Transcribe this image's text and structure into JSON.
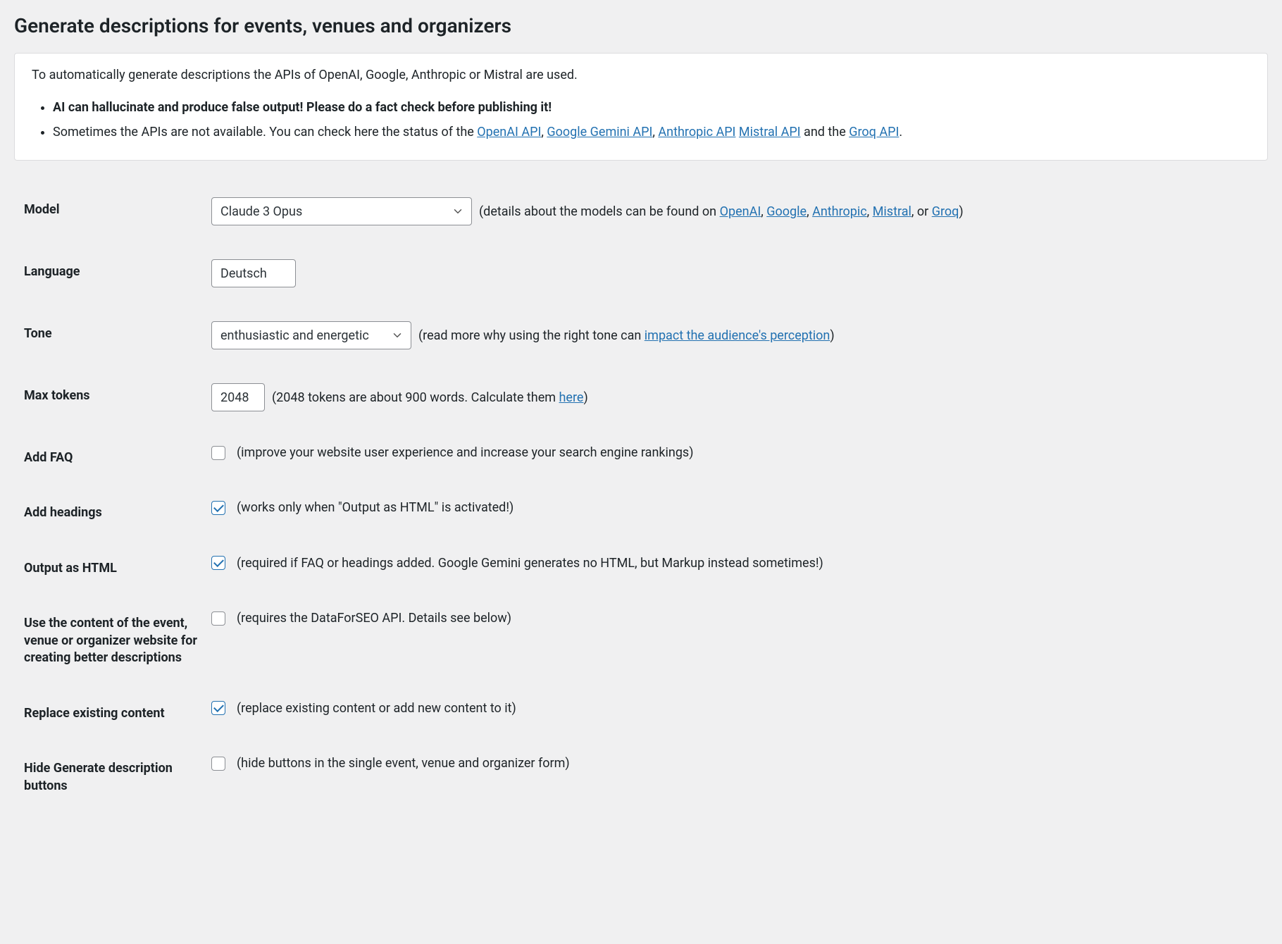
{
  "header": {
    "title": "Generate descriptions for events, venues and organizers"
  },
  "info_box": {
    "intro": "To automatically generate descriptions the APIs of OpenAI, Google, Anthropic or Mistral are used.",
    "warning": "AI can hallucinate and produce false output! Please do a fact check before publishing it!",
    "status_prefix": "Sometimes the APIs are not available. You can check here the status of the ",
    "links": {
      "openai_api": "OpenAI API",
      "gemini_api": "Google Gemini API",
      "anthropic_api": "Anthropic API",
      "mistral_api": "Mistral API",
      "groq_api": "Groq API"
    },
    "status_and": " and the ",
    "period": "."
  },
  "fields": {
    "model": {
      "label": "Model",
      "value": "Claude 3 Opus",
      "hint_prefix": "(details about the models can be found on ",
      "hint_links": {
        "openai": "OpenAI",
        "google": "Google",
        "anthropic": "Anthropic",
        "mistral": "Mistral",
        "groq": "Groq"
      },
      "hint_or": ", or ",
      "hint_suffix": ")"
    },
    "language": {
      "label": "Language",
      "value": "Deutsch"
    },
    "tone": {
      "label": "Tone",
      "value": "enthusiastic and energetic",
      "hint_prefix": "(read more why using the right tone can ",
      "hint_link": "impact the audience's perception",
      "hint_suffix": ")"
    },
    "max_tokens": {
      "label": "Max tokens",
      "value": "2048",
      "hint_prefix": "(2048 tokens are about 900 words. Calculate them ",
      "hint_link": "here",
      "hint_suffix": ")"
    },
    "add_faq": {
      "label": "Add FAQ",
      "checked": false,
      "hint": "(improve your website user experience and increase your search engine rankings)"
    },
    "add_headings": {
      "label": "Add headings",
      "checked": true,
      "hint": "(works only when \"Output as HTML\" is activated!)"
    },
    "output_html": {
      "label": "Output as HTML",
      "checked": true,
      "hint": "(required if FAQ or headings added. Google Gemini generates no HTML, but Markup instead sometimes!)"
    },
    "use_content": {
      "label": "Use the content of the event, venue or organizer website for creating better descriptions",
      "checked": false,
      "hint": "(requires the DataForSEO API. Details see below)"
    },
    "replace_existing": {
      "label": "Replace existing content",
      "checked": true,
      "hint": "(replace existing content or add new content to it)"
    },
    "hide_buttons": {
      "label": "Hide Generate description buttons",
      "checked": false,
      "hint": "(hide buttons in the single event, venue and organizer form)"
    }
  }
}
